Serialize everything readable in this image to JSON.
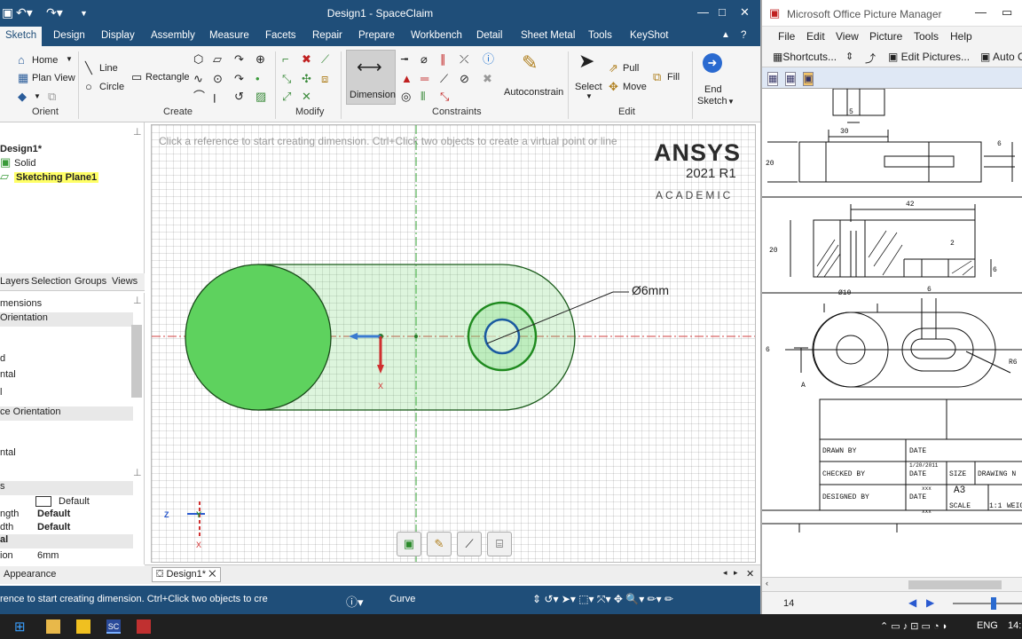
{
  "spaceclaim": {
    "window_title": "Design1 - SpaceClaim",
    "tabs": [
      "Sketch",
      "Design",
      "Display",
      "Assembly",
      "Measure",
      "Facets",
      "Repair",
      "Prepare",
      "Workbench",
      "Detail",
      "Sheet Metal",
      "Tools",
      "KeyShot"
    ],
    "ribbon": {
      "home": "Home",
      "plan_view": "Plan View",
      "line": "Line",
      "circle": "Circle",
      "rectangle": "Rectangle",
      "dimension": "Dimension",
      "autoconstrain": "Autoconstrain",
      "select": "Select",
      "pull": "Pull",
      "move": "Move",
      "fill": "Fill",
      "end_sketch_1": "End",
      "end_sketch_2": "Sketch",
      "groups": [
        "Orient",
        "Create",
        "Modify",
        "Constraints",
        "Edit"
      ]
    },
    "structure": {
      "root": "Design1*",
      "items": [
        "Solid",
        "Sketching Plane1"
      ]
    },
    "panel_tabs": [
      "Layers",
      "Selection",
      "Groups",
      "Views"
    ],
    "props": {
      "rows": [
        "mensions",
        "Orientation",
        "d",
        "ntal",
        "l",
        "ce Orientation",
        "ntal"
      ],
      "style_rows": [
        {
          "label": "s",
          "value": ""
        },
        {
          "label": "",
          "value": "Default"
        },
        {
          "label": "ngth",
          "value": "Default"
        },
        {
          "label": "dth",
          "value": "Default"
        },
        {
          "label": "al",
          "value": ""
        },
        {
          "label": "ion",
          "value": "6mm"
        }
      ]
    },
    "appearance_tab": "Appearance",
    "canvas": {
      "hint": "Click a reference to start creating dimension. Ctrl+Click two objects to create a virtual point or line",
      "brand_1": "ANSYS",
      "brand_2": "2021 R1",
      "brand_3": "ACADEMIC",
      "dim_label": "Ø6mm",
      "axis_x": "X",
      "axis_y": "Y",
      "axis_z": "Z"
    },
    "doc_tab": "Design1*",
    "status_text": "rence to start creating dimension. Ctrl+Click two objects to cre",
    "status_mode": "Curve"
  },
  "picture_manager": {
    "title": "Microsoft Office Picture Manager",
    "menu": [
      "File",
      "Edit",
      "View",
      "Picture",
      "Tools",
      "Help"
    ],
    "toolbar": {
      "shortcuts": "Shortcuts...",
      "edit_pictures": "Edit Pictures...",
      "auto": "Auto C"
    },
    "zoom": "14",
    "drawing": {
      "dims": [
        "5",
        "30",
        "6",
        "20",
        "42",
        "20",
        "2",
        "6",
        "Ø10",
        "6",
        "6",
        "R6",
        "A"
      ],
      "title_block": {
        "drawn_by": "DRAWN BY",
        "checked_by": "CHECKED BY",
        "designed_by": "DESIGNED BY",
        "date1": "DATE",
        "date1_val": "1/20/2011",
        "date2": "DATE",
        "date2_val": "xxx",
        "date3": "DATE",
        "date3_val": "xxx",
        "size": "SIZE",
        "size_val": "A3",
        "drawing_no": "DRAWING N",
        "scale": "SCALE",
        "scale_val": "1:1",
        "weight": "WEIG"
      }
    }
  },
  "taskbar": {
    "lang": "ENG",
    "time": "14:"
  },
  "colors": {
    "sc_blue": "#1f4e79",
    "sketch_green": "#3ec43e",
    "sketch_light": "#9fe59f"
  }
}
